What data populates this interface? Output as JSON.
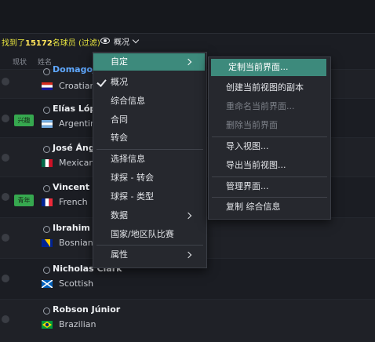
{
  "header": {
    "found_prefix": "找到了",
    "found_count": "15172",
    "found_suffix": "名球员 (过滤)",
    "view_label": "概况"
  },
  "columns": {
    "status": "现状",
    "name": "姓名"
  },
  "players": [
    {
      "name": "Domagoj (",
      "nationality": "Croatian",
      "badge": "",
      "link": true
    },
    {
      "name": "Elías Lópe",
      "nationality": "Argentin",
      "badge": "兴趣",
      "link": false
    },
    {
      "name": "José Ánge",
      "nationality": "Mexican",
      "badge": "",
      "link": false
    },
    {
      "name": "Vincent G",
      "nationality": "French",
      "badge": "青年",
      "link": false
    },
    {
      "name": "Ibrahim B",
      "nationality": "Bosnian",
      "badge": "",
      "link": false
    },
    {
      "name": "Nicholas Clark",
      "nationality": "Scottish",
      "badge": "",
      "link": false
    },
    {
      "name": "Robson Júnior",
      "nationality": "Brazilian",
      "badge": "",
      "link": false
    }
  ],
  "menu": {
    "custom": "自定",
    "overview": "概况",
    "general_info": "综合信息",
    "contract": "合同",
    "transfer": "转会",
    "select_info": "选择信息",
    "scout_transfer": "球探 - 转会",
    "scout_type": "球探 - 类型",
    "data": "数据",
    "national_team": "国家/地区队比赛",
    "attributes": "属性"
  },
  "submenu": {
    "customize_current": "定制当前界面...",
    "create_copy": "创建当前视图的副本",
    "rename": "重命名当前界面...",
    "delete": "删除当前界面",
    "import": "导入视图...",
    "export": "导出当前视图...",
    "manage": "管理界面...",
    "copy_general": "复制 综合信息"
  },
  "colors": {
    "highlight": "#3d8a7c",
    "found": "#e6e33f",
    "badge": "#36a84f"
  }
}
